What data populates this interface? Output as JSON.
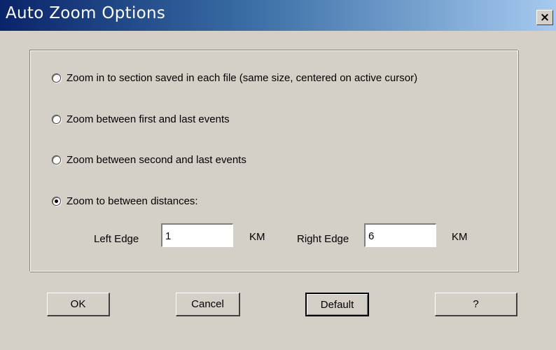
{
  "window": {
    "title": "Auto Zoom Options",
    "close_label": "×"
  },
  "options": [
    {
      "label": "Zoom in to section saved in each file (same size, centered on active cursor)",
      "checked": false
    },
    {
      "label": "Zoom between first and last events",
      "checked": false
    },
    {
      "label": "Zoom between second and last events",
      "checked": false
    },
    {
      "label": "Zoom to between distances:",
      "checked": true
    }
  ],
  "distance": {
    "left_label": "Left Edge",
    "left_value": "1",
    "left_unit": "KM",
    "right_label": "Right Edge",
    "right_value": "6",
    "right_unit": "KM"
  },
  "buttons": {
    "ok": "OK",
    "cancel": "Cancel",
    "default": "Default",
    "help": "?"
  },
  "colors": {
    "dialog_face": "#d4d0c8",
    "title_start": "#0a246a",
    "title_end": "#a6caf0"
  }
}
